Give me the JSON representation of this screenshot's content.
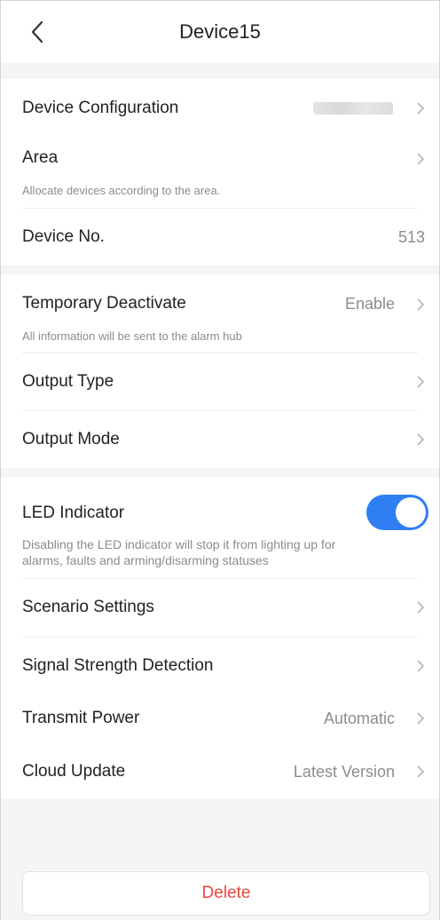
{
  "header": {
    "title": "Device15"
  },
  "group1": {
    "device_configuration": {
      "label": "Device Configuration"
    },
    "area": {
      "label": "Area",
      "description": "Allocate devices according to the area."
    },
    "device_no": {
      "label": "Device No.",
      "value": "513"
    }
  },
  "group2": {
    "temporary_deactivate": {
      "label": "Temporary Deactivate",
      "value": "Enable",
      "description": "All information will be sent to the alarm hub"
    },
    "output_type": {
      "label": "Output Type"
    },
    "output_mode": {
      "label": "Output Mode"
    }
  },
  "group3": {
    "led_indicator": {
      "label": "LED Indicator",
      "enabled": true,
      "description_line1": "Disabling the LED indicator will stop it from lighting up for",
      "description_line2": "alarms, faults and arming/disarming statuses"
    },
    "scenario_settings": {
      "label": "Scenario Settings"
    },
    "signal_strength_detection": {
      "label": "Signal Strength Detection"
    },
    "transmit_power": {
      "label": "Transmit Power",
      "value": "Automatic"
    },
    "cloud_update": {
      "label": "Cloud Update",
      "value": "Latest Version"
    }
  },
  "footer": {
    "delete_label": "Delete"
  },
  "colors": {
    "accent": "#2f7ff2",
    "danger": "#e8453c",
    "muted": "#8c8c8c"
  },
  "icons": {
    "back": "chevron-left-icon",
    "row_arrow": "chevron-right-icon"
  }
}
